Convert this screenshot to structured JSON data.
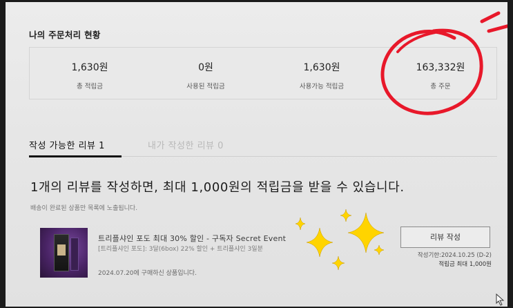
{
  "summary": {
    "title": "나의 주문처리 현황",
    "stats": [
      {
        "value": "1,630원",
        "label": "총 적립금"
      },
      {
        "value": "0원",
        "label": "사용된 적립금"
      },
      {
        "value": "1,630원",
        "label": "사용가능 적립금"
      },
      {
        "value": "163,332원",
        "label": "총 주문"
      }
    ]
  },
  "tabs": [
    {
      "label": "작성 가능한 리뷰 1",
      "active": true
    },
    {
      "label": "내가 작성한 리뷰 0",
      "active": false
    }
  ],
  "review": {
    "headline": "1개의 리뷰를 작성하면, 최대 1,000원의 적립금을 받을 수 있습니다.",
    "notice": "배송이 완료된 상품만 목록에 노출됩니다.",
    "product": {
      "title": "트리플샤인 포도 최대 30% 할인 - 구독자 Secret Event",
      "option": "[트리플샤인 포도]: 3달(6box) 22% 할인 + 트리플샤인 3일분",
      "purchase_date": "2024.07.20에 구매하신 상품입니다."
    },
    "button_label": "리뷰 작성",
    "deadline": "작성기한:2024.10.25 (D-2)",
    "max_points": "적립금 최대 1,000원"
  },
  "colors": {
    "annotation_circle": "#e8182a",
    "sparkle": "#ffd400",
    "screen_bg": "#e8e8e8"
  }
}
